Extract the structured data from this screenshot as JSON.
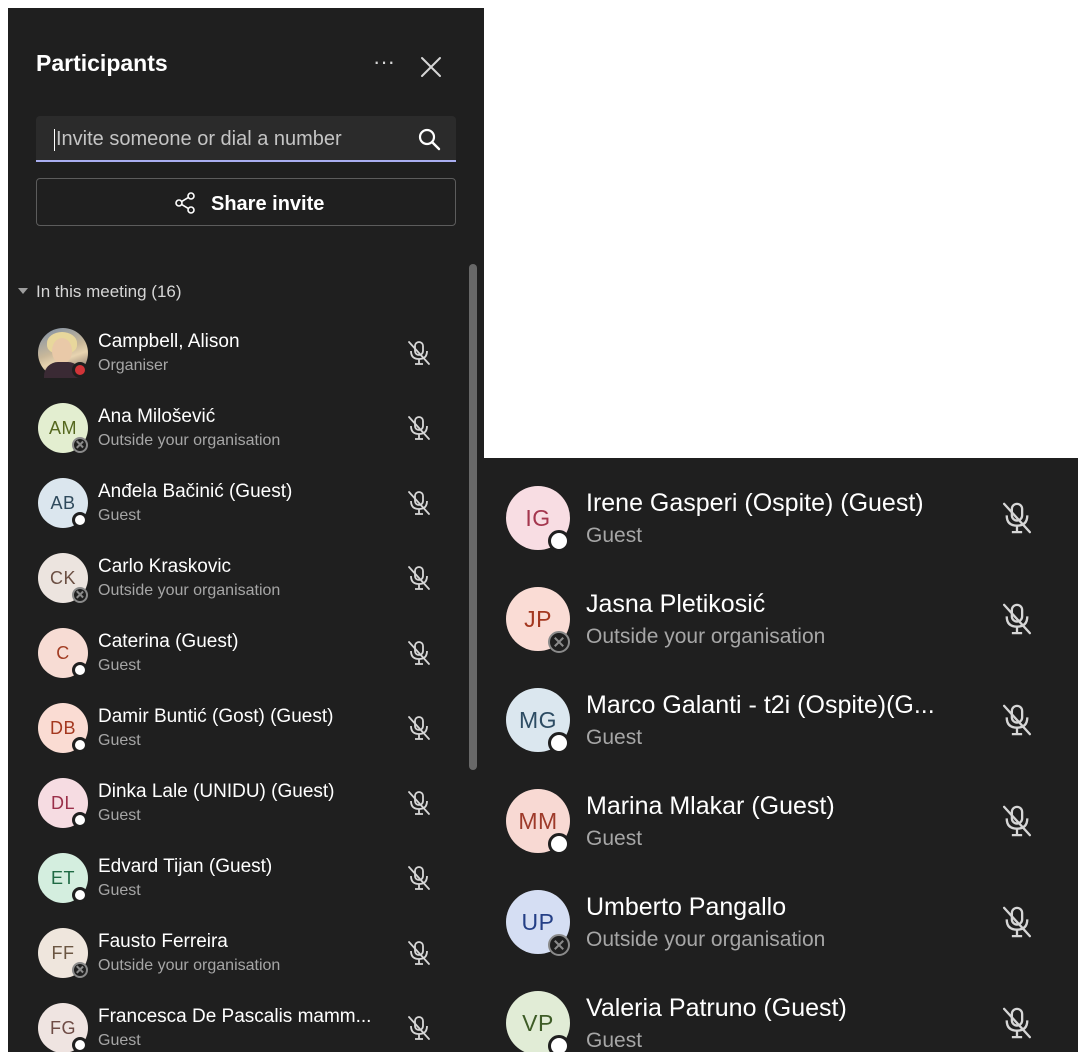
{
  "panel": {
    "title": "Participants",
    "more_label": "···",
    "search_placeholder": "Invite someone or dial a number",
    "share_label": "Share invite",
    "section_label": "In this meeting (16)"
  },
  "participants": [
    {
      "initials": "",
      "name": "Campbell, Alison",
      "role": "Organiser",
      "avatar_bg": "photo",
      "initials_color": "",
      "status": "busy"
    },
    {
      "initials": "AM",
      "name": "Ana Milošević",
      "role": "Outside your organisation",
      "avatar_bg": "#e3eed0",
      "initials_color": "#55681f",
      "status": "unknown"
    },
    {
      "initials": "AB",
      "name": "Anđela Bačinić (Guest)",
      "role": "Guest",
      "avatar_bg": "#dbe6ee",
      "initials_color": "#2f4a5c",
      "status": "available"
    },
    {
      "initials": "CK",
      "name": "Carlo Kraskovic",
      "role": "Outside your organisation",
      "avatar_bg": "#ece4df",
      "initials_color": "#6b4f43",
      "status": "unknown"
    },
    {
      "initials": "C",
      "name": "Caterina (Guest)",
      "role": "Guest",
      "avatar_bg": "#f7dcd4",
      "initials_color": "#a23d23",
      "status": "available"
    },
    {
      "initials": "DB",
      "name": "Damir Buntić (Gost) (Guest)",
      "role": "Guest",
      "avatar_bg": "#fadcd3",
      "initials_color": "#a4381f",
      "status": "available"
    },
    {
      "initials": "DL",
      "name": "Dinka Lale (UNIDU) (Guest)",
      "role": "Guest",
      "avatar_bg": "#f6dce2",
      "initials_color": "#9a2f49",
      "status": "available"
    },
    {
      "initials": "ET",
      "name": "Edvard Tijan (Guest)",
      "role": "Guest",
      "avatar_bg": "#d4eedf",
      "initials_color": "#1f6a44",
      "status": "available"
    },
    {
      "initials": "FF",
      "name": "Fausto Ferreira",
      "role": "Outside your organisation",
      "avatar_bg": "#efe6dd",
      "initials_color": "#6b5642",
      "status": "unknown"
    },
    {
      "initials": "FG",
      "name": "Francesca De Pascalis mamm...",
      "role": "Guest",
      "avatar_bg": "#efe4e1",
      "initials_color": "#6e4b45",
      "status": "available"
    }
  ],
  "participants_continued": [
    {
      "initials": "IG",
      "name": "Irene Gasperi (Ospite) (Guest)",
      "role": "Guest",
      "avatar_bg": "#f8dde3",
      "initials_color": "#a4364e",
      "status": "available"
    },
    {
      "initials": "JP",
      "name": "Jasna Pletikosić",
      "role": "Outside your organisation",
      "avatar_bg": "#fadcd5",
      "initials_color": "#a3371f",
      "status": "unknown"
    },
    {
      "initials": "MG",
      "name": "Marco Galanti - t2i (Ospite)(G...",
      "role": "Guest",
      "avatar_bg": "#dbe7ef",
      "initials_color": "#2d4c63",
      "status": "available"
    },
    {
      "initials": "MM",
      "name": "Marina Mlakar (Guest)",
      "role": "Guest",
      "avatar_bg": "#f8d9d3",
      "initials_color": "#9e3a2a",
      "status": "available"
    },
    {
      "initials": "UP",
      "name": "Umberto Pangallo",
      "role": "Outside your organisation",
      "avatar_bg": "#d5def3",
      "initials_color": "#243f86",
      "status": "unknown"
    },
    {
      "initials": "VP",
      "name": "Valeria Patruno (Guest)",
      "role": "Guest",
      "avatar_bg": "#e1ecd6",
      "initials_color": "#3e5c27",
      "status": "available"
    }
  ]
}
